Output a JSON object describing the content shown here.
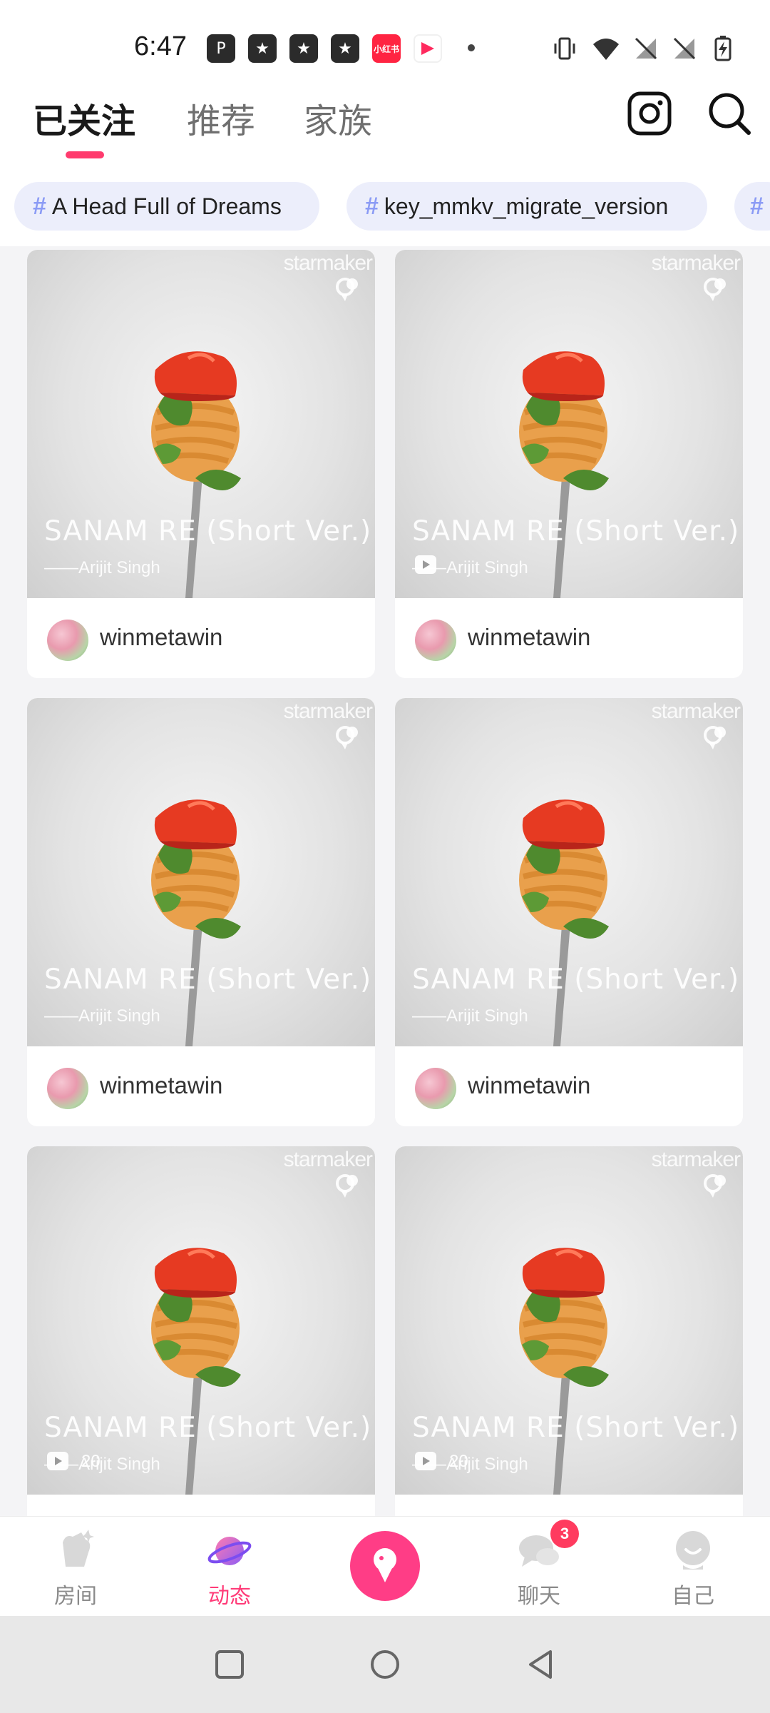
{
  "status_bar": {
    "time": "6:47",
    "notif_icons": [
      "p-icon",
      "star-icon",
      "star-icon",
      "star-icon",
      "xiaohongshu-icon",
      "app-icon"
    ],
    "xiaohongshu_label": "小红书"
  },
  "header": {
    "tabs": [
      {
        "label": "已关注",
        "active": true
      },
      {
        "label": "推荐",
        "active": false
      },
      {
        "label": "家族",
        "active": false
      }
    ],
    "icons": [
      "instagram-icon",
      "search-icon"
    ]
  },
  "hashtags": [
    {
      "label": "A Head Full of Dreams"
    },
    {
      "label": "key_mmkv_migrate_version"
    }
  ],
  "feed": {
    "watermark": "starmaker",
    "cards": [
      {
        "title": "SANAM RE (Short Ver.)",
        "artist": "——Arijit Singh",
        "author": "winmetawin",
        "play_count": ""
      },
      {
        "title": "SANAM RE (Short Ver.)",
        "artist": "——Arijit Singh",
        "author": "winmetawin",
        "play_count": ""
      },
      {
        "title": "SANAM RE (Short Ver.)",
        "artist": "——Arijit Singh",
        "author": "winmetawin",
        "play_count": ""
      },
      {
        "title": "SANAM RE (Short Ver.)",
        "artist": "——Arijit Singh",
        "author": "winmetawin",
        "play_count": ""
      },
      {
        "title": "SANAM RE (Short Ver.)",
        "artist": "——Arijit Singh",
        "author": "",
        "play_count": "20"
      },
      {
        "title": "SANAM RE (Short Ver.)",
        "artist": "——Arijit Singh",
        "author": "",
        "play_count": "20"
      }
    ]
  },
  "bottom_nav": {
    "items": [
      {
        "label": "房间",
        "icon": "room-icon",
        "active": false
      },
      {
        "label": "动态",
        "icon": "planet-icon",
        "active": true
      },
      {
        "label": "",
        "icon": "microphone-icon",
        "active": false
      },
      {
        "label": "聊天",
        "icon": "chat-icon",
        "active": false,
        "badge": "3"
      },
      {
        "label": "自己",
        "icon": "profile-icon",
        "active": false
      }
    ]
  },
  "colors": {
    "accent": "#ff3b78",
    "chip_bg": "#eceefb",
    "hash": "#8b9bf5"
  }
}
